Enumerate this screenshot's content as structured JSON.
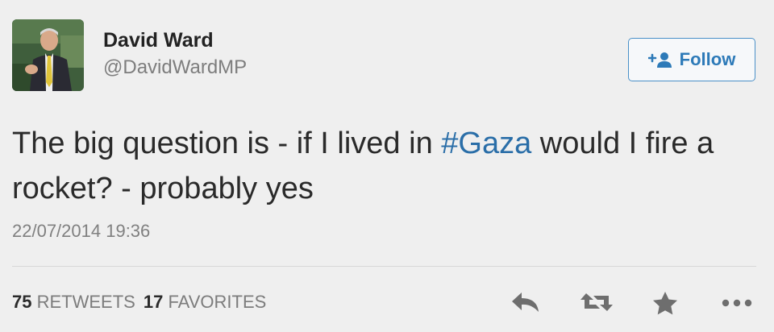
{
  "user": {
    "name": "David Ward",
    "handle": "@DavidWardMP"
  },
  "follow": {
    "label": "Follow",
    "icon": "add-user-icon"
  },
  "tweet": {
    "text_before": "The big question is - if I lived in ",
    "hashtag": "#Gaza",
    "text_after": " would I fire a rocket? - probably yes",
    "timestamp": "22/07/2014 19:36"
  },
  "stats": {
    "retweets_count": "75",
    "retweets_label": "RETWEETS",
    "favorites_count": "17",
    "favorites_label": "FAVORITES"
  },
  "actions": [
    "reply-icon",
    "retweet-icon",
    "favorite-star-icon",
    "more-options-icon"
  ],
  "colors": {
    "accent": "#2d7ab8",
    "hashtag": "#2a6ea8",
    "muted": "#7c7c7c",
    "background": "#efefef"
  }
}
